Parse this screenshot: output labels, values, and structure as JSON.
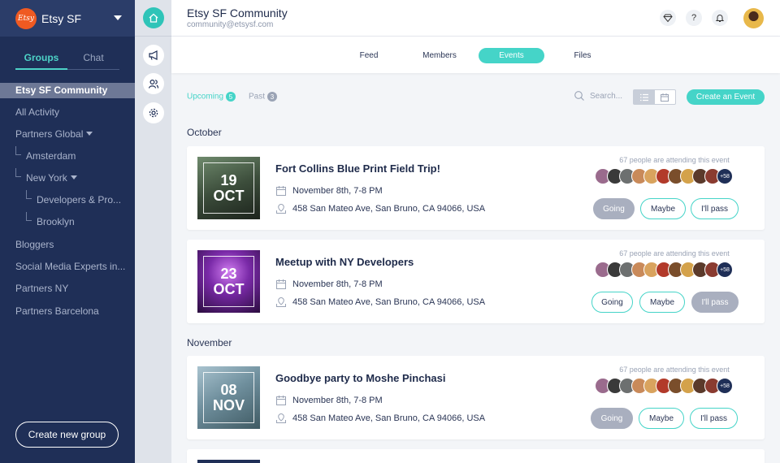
{
  "sidebar": {
    "org_logo": "Etsy",
    "org_name": "Etsy SF",
    "tabs": [
      "Groups",
      "Chat"
    ],
    "groups": [
      "Etsy SF Community",
      "All Activity",
      "Partners Global",
      "Amsterdam",
      "New York",
      "Developers & Pro...",
      "Brooklyn",
      "Bloggers",
      "Social Media Experts in...",
      "Partners NY",
      "Partners Barcelona"
    ],
    "create_group": "Create new group"
  },
  "header": {
    "title": "Etsy SF Community",
    "email": "community@etsysf.com",
    "help": "?"
  },
  "section_tabs": [
    "Feed",
    "Members",
    "Events",
    "Files"
  ],
  "filters": {
    "upcoming_label": "Upcoming",
    "upcoming_count": "5",
    "past_label": "Past",
    "past_count": "3",
    "search_placeholder": "Search...",
    "create_event": "Create an Event"
  },
  "months": [
    "October",
    "November"
  ],
  "events": [
    {
      "day": "19",
      "month": "OCT",
      "title": "Fort Collins Blue Print Field Trip!",
      "when": "November 8th, 7-8 PM",
      "where": "458 San Mateo Ave, San Bruno, CA 94066, USA",
      "attending": "67 people are attending this event",
      "more": "+58",
      "going": "Going",
      "maybe": "Maybe",
      "pass": "I'll pass",
      "selected": "going"
    },
    {
      "day": "23",
      "month": "OCT",
      "title": "Meetup with NY Developers",
      "when": "November 8th, 7-8 PM",
      "where": "458 San Mateo Ave, San Bruno, CA 94066, USA",
      "attending": "67 people are attending this event",
      "more": "+58",
      "going": "Going",
      "maybe": "Maybe",
      "pass": "I'll pass",
      "selected": "pass"
    },
    {
      "day": "08",
      "month": "NOV",
      "title": "Goodbye party to Moshe Pinchasi",
      "when": "November 8th, 7-8 PM",
      "where": "458 San Mateo Ave, San Bruno, CA 94066, USA",
      "attending": "67 people are attending this event",
      "more": "+58",
      "going": "Going",
      "maybe": "Maybe",
      "pass": "I'll pass",
      "selected": "going"
    }
  ],
  "colors": {
    "accent": "#45d4c8",
    "sidebar_bg": "#1f2f57",
    "selected_rsvp": "#a9afbf"
  }
}
